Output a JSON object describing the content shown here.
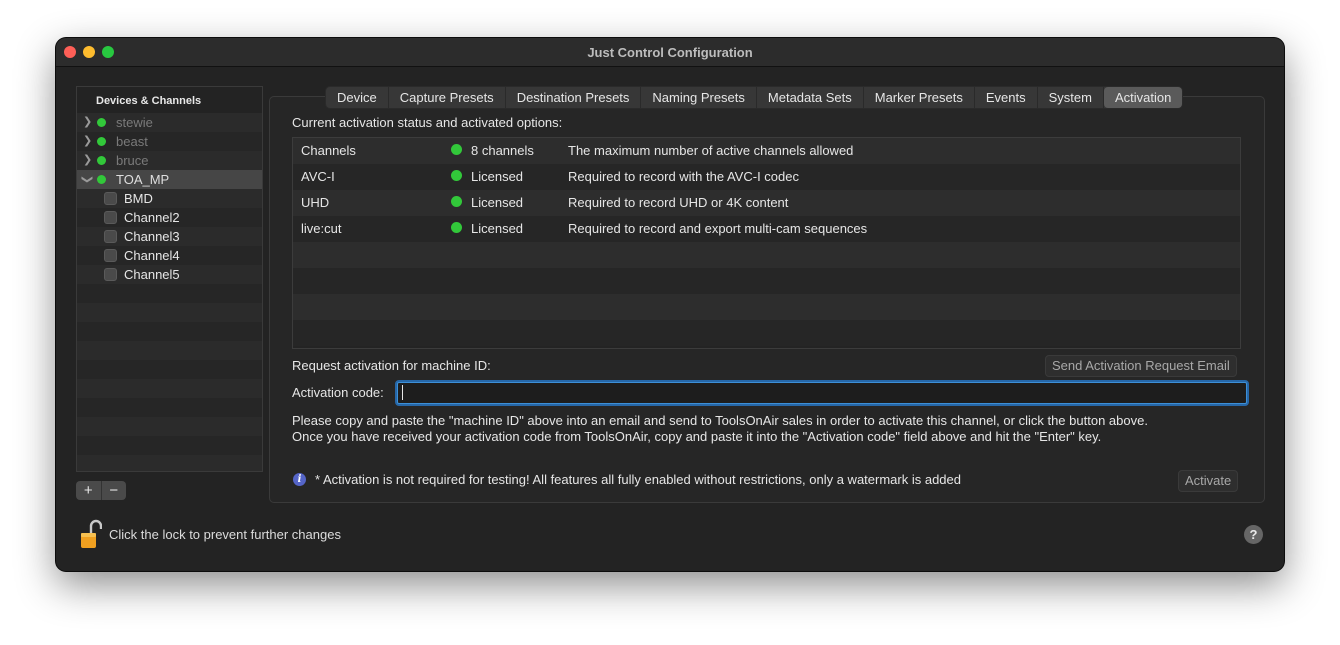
{
  "window": {
    "title": "Just Control Configuration"
  },
  "sidebar": {
    "header": "Devices & Channels",
    "devices": [
      {
        "label": "stewie",
        "expanded": false,
        "dimmed": true
      },
      {
        "label": "beast",
        "expanded": false,
        "dimmed": true
      },
      {
        "label": "bruce",
        "expanded": false,
        "dimmed": true
      },
      {
        "label": "TOA_MP",
        "expanded": true,
        "dimmed": false
      }
    ],
    "channels": [
      "BMD",
      "Channel2",
      "Channel3",
      "Channel4",
      "Channel5"
    ],
    "add_label": "+",
    "remove_label": "−"
  },
  "tabs": [
    {
      "label": "Device"
    },
    {
      "label": "Capture Presets"
    },
    {
      "label": "Destination Presets"
    },
    {
      "label": "Naming Presets"
    },
    {
      "label": "Metadata Sets"
    },
    {
      "label": "Marker Presets"
    },
    {
      "label": "Events"
    },
    {
      "label": "System"
    },
    {
      "label": "Activation",
      "active": true
    }
  ],
  "activation": {
    "status_title": "Current activation status and activated options:",
    "options": [
      {
        "name": "Channels",
        "status": "8 channels",
        "description": "The maximum number of active channels allowed"
      },
      {
        "name": "AVC-I",
        "status": "Licensed",
        "description": "Required to record with the AVC-I codec"
      },
      {
        "name": "UHD",
        "status": "Licensed",
        "description": "Required to record UHD or 4K content"
      },
      {
        "name": "live:cut",
        "status": "Licensed",
        "description": "Required to record and export multi-cam sequences"
      }
    ],
    "request_label": "Request activation for machine ID:",
    "send_button": "Send Activation Request Email",
    "code_label": "Activation code:",
    "code_value": "",
    "help_line1": "Please copy and paste the \"machine ID\" above into an email and send to ToolsOnAir sales in order to activate this channel, or click the button above.",
    "help_line2": "Once you have received your activation code from ToolsOnAir, copy and paste it into the \"Activation code\" field above and hit the \"Enter\" key.",
    "note": "* Activation is not required for testing! All features all fully enabled without restrictions, only a watermark is added",
    "activate_button": "Activate"
  },
  "footer": {
    "lock_text": "Click the lock to prevent further changes",
    "help_label": "?"
  },
  "colors": {
    "status_green": "#32c83a",
    "focus_blue": "#3d8fd6",
    "info_blue": "#5565c8",
    "lock_gold": "#f0a020"
  }
}
